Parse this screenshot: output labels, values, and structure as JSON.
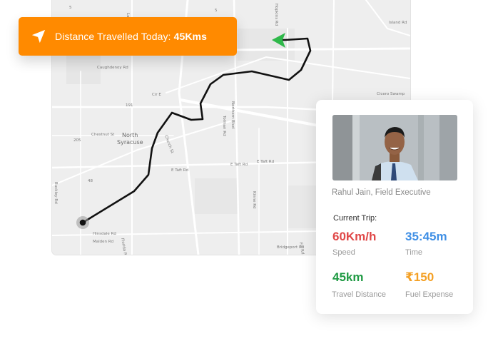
{
  "banner": {
    "label": "Distance Travelled Today:",
    "value": "45Kms",
    "icon": "navigation-arrow-icon"
  },
  "map": {
    "area_label": "North Syracuse",
    "street_labels": [
      "Lawrence",
      "Hopkins Rd",
      "Island Rd",
      "Caughdenoy Rd",
      "Cicero Swamp",
      "Chestnut St",
      "Northern Blvd",
      "Tolman Rd",
      "Church St",
      "E Taft Rd",
      "Buckley Rd",
      "Hinsdale Rd",
      "Malden Rd",
      "Bridgeport Rd",
      "Fly Rd",
      "Kinne Rd",
      "Florida Rd",
      "191",
      "205",
      "48",
      "Cir E"
    ],
    "route_color": "#111111",
    "destination_arrow_color": "#2fb84a"
  },
  "profile": {
    "name": "Rahul Jain, Field Executive",
    "photo": "profile-photo"
  },
  "trip": {
    "heading": "Current Trip:",
    "stats": [
      {
        "value": "60Km/h",
        "label": "Speed",
        "color": "#e04848"
      },
      {
        "value": "35:45m",
        "label": "Time",
        "color": "#3f8fe5"
      },
      {
        "value": "45km",
        "label": "Travel Distance",
        "color": "#1f9a43"
      },
      {
        "value": "₹150",
        "label": "Fuel Expense",
        "color": "#f4a024"
      }
    ]
  },
  "colors": {
    "accent_orange": "#ff8a00",
    "map_background": "#eeeeee"
  }
}
